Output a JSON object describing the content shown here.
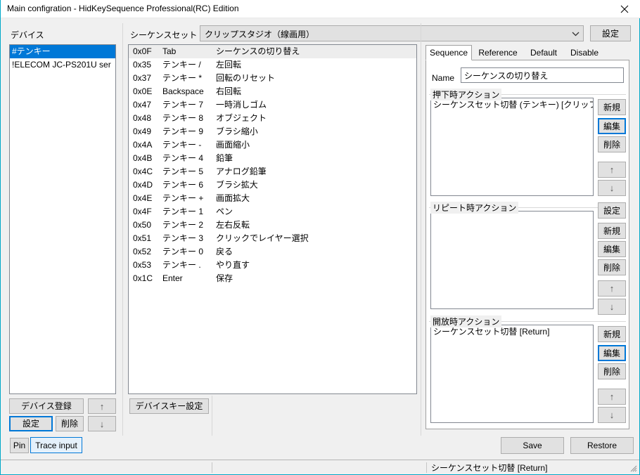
{
  "window": {
    "title": "Main configration - HidKeySequence Professional(RC) Edition",
    "close_icon": "close-icon"
  },
  "device_panel": {
    "label": "デバイス",
    "items": [
      {
        "text": "#テンキー",
        "selected": true
      },
      {
        "text": "!ELECOM JC-PS201U ser",
        "selected": false
      }
    ],
    "buttons": {
      "register": "デバイス登録",
      "settings": "設定",
      "delete": "削除",
      "move_up": "↑",
      "move_down": "↓"
    }
  },
  "sequence_panel": {
    "label": "シーケンスセット",
    "combo_value": "クリップスタジオ（線画用）",
    "combo_arrow_icon": "chevron-down-icon",
    "settings_button": "設定",
    "device_key_button": "デバイスキー設定",
    "rows": [
      {
        "code": "0x0F",
        "key": "Tab",
        "desc": "シーケンスの切り替え",
        "selected": true
      },
      {
        "code": "0x35",
        "key": "テンキー /",
        "desc": "左回転",
        "selected": false
      },
      {
        "code": "0x37",
        "key": "テンキー *",
        "desc": "回転のリセット",
        "selected": false
      },
      {
        "code": "0x0E",
        "key": "Backspace",
        "desc": "右回転",
        "selected": false
      },
      {
        "code": "0x47",
        "key": "テンキー 7",
        "desc": "一時消しゴム",
        "selected": false
      },
      {
        "code": "0x48",
        "key": "テンキー 8",
        "desc": "オブジェクト",
        "selected": false
      },
      {
        "code": "0x49",
        "key": "テンキー 9",
        "desc": "ブラシ縮小",
        "selected": false
      },
      {
        "code": "0x4A",
        "key": "テンキー -",
        "desc": "画面縮小",
        "selected": false
      },
      {
        "code": "0x4B",
        "key": "テンキー 4",
        "desc": "鉛筆",
        "selected": false
      },
      {
        "code": "0x4C",
        "key": "テンキー 5",
        "desc": "アナログ鉛筆",
        "selected": false
      },
      {
        "code": "0x4D",
        "key": "テンキー 6",
        "desc": "ブラシ拡大",
        "selected": false
      },
      {
        "code": "0x4E",
        "key": "テンキー +",
        "desc": "画面拡大",
        "selected": false
      },
      {
        "code": "0x4F",
        "key": "テンキー 1",
        "desc": "ペン",
        "selected": false
      },
      {
        "code": "0x50",
        "key": "テンキー 2",
        "desc": "左右反転",
        "selected": false
      },
      {
        "code": "0x51",
        "key": "テンキー 3",
        "desc": "クリックでレイヤー選択",
        "selected": false
      },
      {
        "code": "0x52",
        "key": "テンキー 0",
        "desc": "戻る",
        "selected": false
      },
      {
        "code": "0x53",
        "key": "テンキー .",
        "desc": "やり直す",
        "selected": false
      },
      {
        "code": "0x1C",
        "key": "Enter",
        "desc": "保存",
        "selected": false
      }
    ]
  },
  "detail_panel": {
    "tabs": [
      {
        "label": "Sequence",
        "active": true
      },
      {
        "label": "Reference",
        "active": false
      },
      {
        "label": "Default",
        "active": false
      },
      {
        "label": "Disable",
        "active": false
      }
    ],
    "name_label": "Name",
    "name_value": "シーケンスの切り替え",
    "press_group": {
      "caption": "押下時アクション",
      "items": [
        "シーケンスセット切替 (テンキー) [クリップスタジオ"
      ],
      "buttons": {
        "new": "新規",
        "edit": "編集",
        "delete": "削除",
        "move_up": "↑",
        "move_down": "↓"
      }
    },
    "repeat_group": {
      "caption": "リピート時アクション",
      "items": [],
      "buttons": {
        "settings": "設定",
        "new": "新規",
        "edit": "編集",
        "delete": "削除",
        "move_up": "↑",
        "move_down": "↓"
      }
    },
    "release_group": {
      "caption": "開放時アクション",
      "items": [
        "シーケンスセット切替 [Return]"
      ],
      "buttons": {
        "new": "新規",
        "edit": "編集",
        "delete": "削除",
        "move_up": "↑",
        "move_down": "↓"
      }
    }
  },
  "footer": {
    "pin_button": "Pin",
    "trace_button": "Trace input",
    "save_button": "Save",
    "restore_button": "Restore"
  },
  "statusbar": {
    "cell1": "",
    "cell2": "",
    "cell3": "シーケンスセット切替 [Return]"
  },
  "colors": {
    "accent": "#0078d7",
    "window_border": "#00a8c8",
    "button_face": "#e1e1e1",
    "selection_gray": "#ededed"
  }
}
